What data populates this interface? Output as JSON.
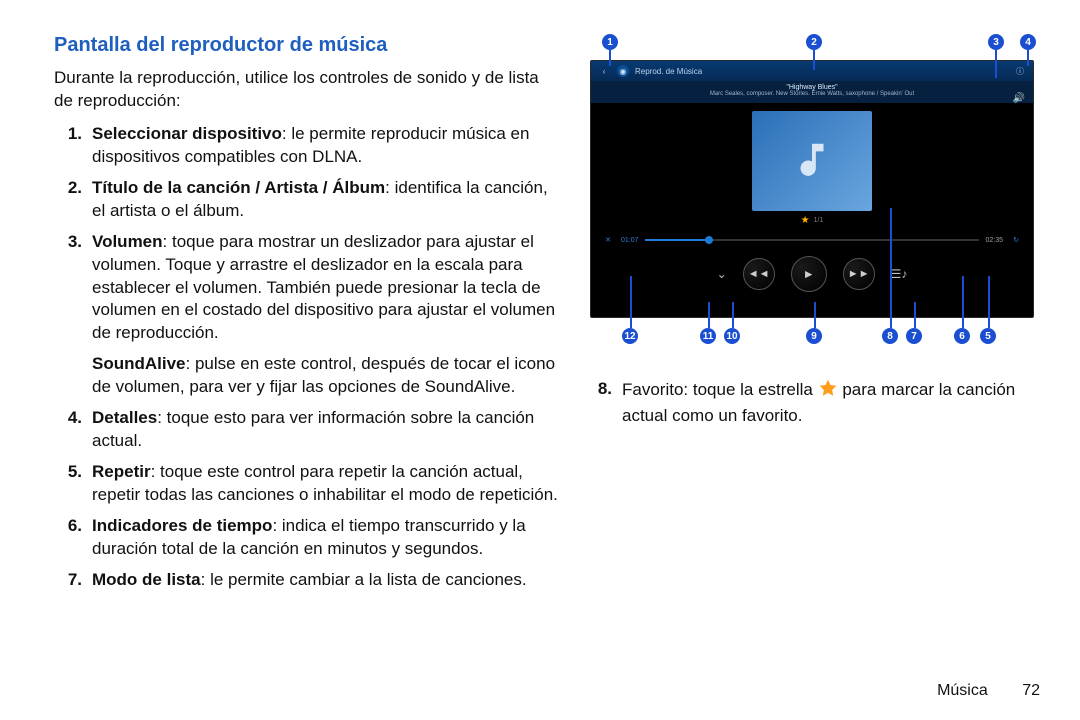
{
  "title": "Pantalla del reproductor de música",
  "intro": "Durante la reproducción, utilice los controles de sonido y de lista de reproducción:",
  "items": [
    {
      "n": "1.",
      "lead": "Seleccionar dispositivo",
      "text": ": le permite reproducir música en dispositivos compatibles con DLNA."
    },
    {
      "n": "2.",
      "lead": "Título de la canción / Artista / Álbum",
      "text": ": identifica la canción, el artista o el álbum."
    },
    {
      "n": "3.",
      "lead": "Volumen",
      "text": ": toque para mostrar un deslizador para ajustar el volumen. Toque y arrastre el deslizador en la escala para establecer el volumen. También puede presionar la tecla de volumen en el costado del dispositivo para ajustar el volumen de reproducción."
    },
    {
      "n": "4.",
      "lead": "Detalles",
      "text": ": toque esto para ver información sobre la canción actual."
    },
    {
      "n": "5.",
      "lead": "Repetir",
      "text": ": toque este control para repetir la canción actual, repetir todas las canciones o inhabilitar el modo de repetición."
    },
    {
      "n": "6.",
      "lead": "Indicadores de tiempo",
      "text": ": indica el tiempo transcurrido y la duración total de la canción en minutos y segundos."
    },
    {
      "n": "7.",
      "lead": "Modo de lista",
      "text": ": le permite cambiar a la lista de canciones."
    }
  ],
  "soundalive": {
    "lead": "SoundAlive",
    "text": ": pulse en este control, después de tocar el icono de volumen, para ver y fijar las opciones de SoundAlive."
  },
  "right_item": {
    "n": "8.",
    "lead": "Favorito",
    "text_before": ": toque la estrella ",
    "text_after": " para marcar la canción actual como un favorito."
  },
  "footer": {
    "section": "Música",
    "page": "72"
  },
  "player": {
    "header": "Reprod. de Música",
    "song": "\"Highway Blues\"",
    "artist": "Marc Seales, composer. New Stories. Ernie Watts, saxophone / Speakin' Out",
    "counter": "1/1",
    "elapsed": "01:07",
    "total": "02:35"
  },
  "callouts": {
    "top": [
      "1",
      "2",
      "3",
      "4"
    ],
    "bottom": [
      "12",
      "11",
      "10",
      "9",
      "8",
      "7",
      "6",
      "5"
    ]
  }
}
